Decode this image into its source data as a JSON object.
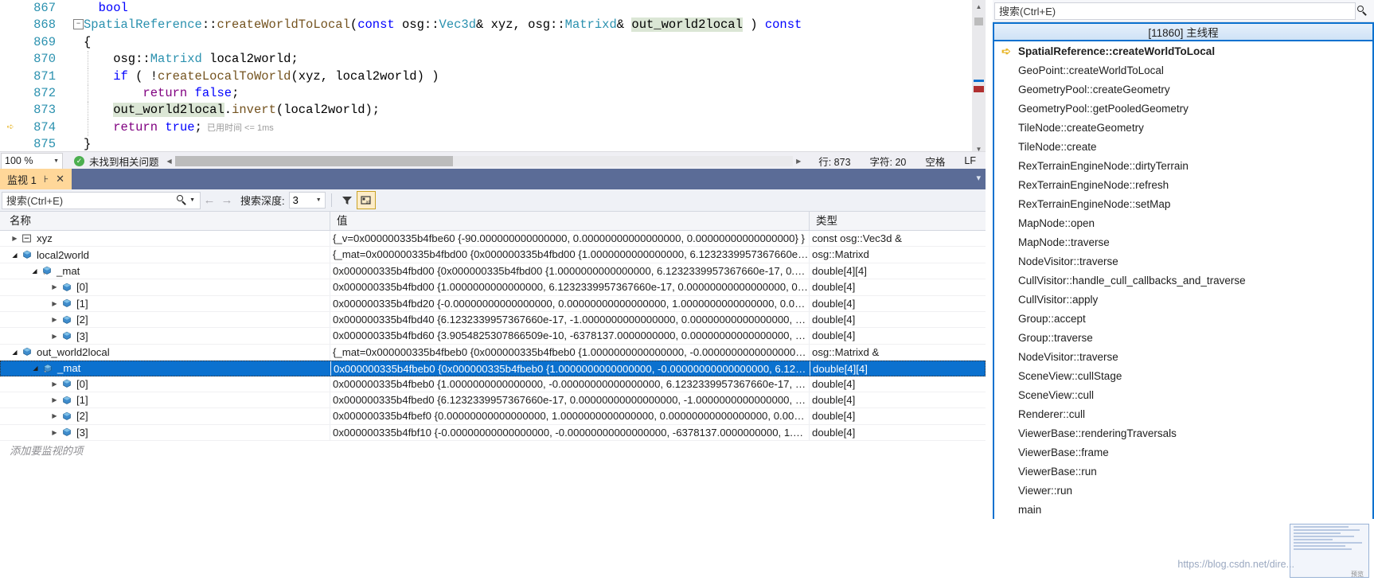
{
  "editor": {
    "lines": [
      {
        "num": "867",
        "fold": false,
        "current": false,
        "indent": false,
        "segments": [
          {
            "t": "  bool",
            "c": "kw"
          }
        ]
      },
      {
        "num": "868",
        "fold": true,
        "current": false,
        "indent": false,
        "segments": [
          {
            "t": "SpatialReference",
            "c": "typ"
          },
          {
            "t": "::",
            "c": ""
          },
          {
            "t": "createWorldToLocal",
            "c": "fn"
          },
          {
            "t": "(",
            "c": ""
          },
          {
            "t": "const",
            "c": "kw"
          },
          {
            "t": " osg::",
            "c": ""
          },
          {
            "t": "Vec3d",
            "c": "typ"
          },
          {
            "t": "& xyz, osg::",
            "c": ""
          },
          {
            "t": "Matrixd",
            "c": "typ"
          },
          {
            "t": "& ",
            "c": ""
          },
          {
            "t": "out_world2local",
            "c": "hl"
          },
          {
            "t": " ) ",
            "c": ""
          },
          {
            "t": "const",
            "c": "kw"
          }
        ]
      },
      {
        "num": "869",
        "fold": false,
        "current": false,
        "indent": false,
        "segments": [
          {
            "t": "{",
            "c": ""
          }
        ]
      },
      {
        "num": "870",
        "fold": false,
        "current": false,
        "indent": true,
        "segments": [
          {
            "t": "    osg::",
            "c": ""
          },
          {
            "t": "Matrixd",
            "c": "typ"
          },
          {
            "t": " local2world;",
            "c": ""
          }
        ]
      },
      {
        "num": "871",
        "fold": false,
        "current": false,
        "indent": true,
        "segments": [
          {
            "t": "    ",
            "c": ""
          },
          {
            "t": "if",
            "c": "kw"
          },
          {
            "t": " ( !",
            "c": ""
          },
          {
            "t": "createLocalToWorld",
            "c": "fn"
          },
          {
            "t": "(xyz, local2world) )",
            "c": ""
          }
        ]
      },
      {
        "num": "872",
        "fold": false,
        "current": false,
        "indent": true,
        "segments": [
          {
            "t": "        ",
            "c": ""
          },
          {
            "t": "return",
            "c": "mac"
          },
          {
            "t": " ",
            "c": ""
          },
          {
            "t": "false",
            "c": "kw"
          },
          {
            "t": ";",
            "c": ""
          }
        ]
      },
      {
        "num": "873",
        "fold": false,
        "current": false,
        "indent": true,
        "segments": [
          {
            "t": "    ",
            "c": ""
          },
          {
            "t": "out_world2local",
            "c": "hl"
          },
          {
            "t": ".",
            "c": ""
          },
          {
            "t": "invert",
            "c": "fn"
          },
          {
            "t": "(local2world);",
            "c": ""
          }
        ]
      },
      {
        "num": "874",
        "fold": false,
        "current": true,
        "indent": true,
        "segments": [
          {
            "t": "    ",
            "c": ""
          },
          {
            "t": "return",
            "c": "mac"
          },
          {
            "t": " ",
            "c": ""
          },
          {
            "t": "true",
            "c": "kw"
          },
          {
            "t": ";",
            "c": ""
          }
        ],
        "tooltip": "已用时间 <= 1ms"
      },
      {
        "num": "875",
        "fold": false,
        "current": false,
        "indent": false,
        "segments": [
          {
            "t": "}",
            "c": ""
          }
        ]
      }
    ],
    "status": {
      "zoom": "100 %",
      "issues": "未找到相关问题",
      "line": "行: 873",
      "column": "字符: 20",
      "spaces": "空格",
      "eol": "LF"
    }
  },
  "watch": {
    "tab_label": "监视 1",
    "pin_icon": "pin-icon",
    "close_icon": "close-icon",
    "search_placeholder": "搜索(Ctrl+E)",
    "depth_label": "搜索深度:",
    "depth_value": "3",
    "toolbar_icons": [
      "filter-icon",
      "hex-display-icon"
    ],
    "columns": [
      "名称",
      "值",
      "类型"
    ],
    "add_item_hint": "添加要监视的项",
    "rows": [
      {
        "indent": 0,
        "twisty": "collapsed",
        "icon": "struct-icon",
        "name": "xyz",
        "value": "{_v=0x000000335b4fbe60 {-90.000000000000000, 0.00000000000000000, 0.00000000000000000} }",
        "type": "const osg::Vec3d &",
        "selected": false
      },
      {
        "indent": 0,
        "twisty": "expanded",
        "icon": "field-icon",
        "name": "local2world",
        "value": "{_mat=0x000000335b4fbd00 {0x000000335b4fbd00 {1.0000000000000000, 6.1232339957367660e-…",
        "type": "osg::Matrixd",
        "selected": false
      },
      {
        "indent": 1,
        "twisty": "expanded",
        "icon": "private-field-icon",
        "name": "_mat",
        "value": "0x000000335b4fbd00 {0x000000335b4fbd00 {1.0000000000000000, 6.1232339957367660e-17, 0.0…",
        "type": "double[4][4]",
        "selected": false
      },
      {
        "indent": 2,
        "twisty": "collapsed",
        "icon": "field-icon",
        "name": "[0]",
        "value": "0x000000335b4fbd00 {1.0000000000000000, 6.1232339957367660e-17, 0.00000000000000000, 0.0…",
        "type": "double[4]",
        "selected": false
      },
      {
        "indent": 2,
        "twisty": "collapsed",
        "icon": "field-icon",
        "name": "[1]",
        "value": "0x000000335b4fbd20 {-0.00000000000000000, 0.00000000000000000, 1.0000000000000000, 0.000…",
        "type": "double[4]",
        "selected": false
      },
      {
        "indent": 2,
        "twisty": "collapsed",
        "icon": "field-icon",
        "name": "[2]",
        "value": "0x000000335b4fbd40 {6.1232339957367660e-17, -1.0000000000000000, 0.00000000000000000, 0…",
        "type": "double[4]",
        "selected": false
      },
      {
        "indent": 2,
        "twisty": "collapsed",
        "icon": "field-icon",
        "name": "[3]",
        "value": "0x000000335b4fbd60 {3.9054825307866509e-10, -6378137.0000000000, 0.00000000000000000, 1…",
        "type": "double[4]",
        "selected": false
      },
      {
        "indent": 0,
        "twisty": "expanded",
        "icon": "field-icon",
        "name": "out_world2local",
        "value": "{_mat=0x000000335b4fbeb0 {0x000000335b4fbeb0 {1.0000000000000000, -0.00000000000000000…",
        "type": "osg::Matrixd &",
        "selected": false
      },
      {
        "indent": 1,
        "twisty": "expanded",
        "icon": "private-field-icon",
        "name": "_mat",
        "value": "0x000000335b4fbeb0 {0x000000335b4fbeb0 {1.0000000000000000, -0.00000000000000000, 6.123…",
        "type": "double[4][4]",
        "selected": true
      },
      {
        "indent": 2,
        "twisty": "collapsed",
        "icon": "field-icon",
        "name": "[0]",
        "value": "0x000000335b4fbeb0 {1.0000000000000000, -0.00000000000000000, 6.1232339957367660e-17, 0…",
        "type": "double[4]",
        "selected": false
      },
      {
        "indent": 2,
        "twisty": "collapsed",
        "icon": "field-icon",
        "name": "[1]",
        "value": "0x000000335b4fbed0 {6.1232339957367660e-17, 0.00000000000000000, -1.0000000000000000, 0…",
        "type": "double[4]",
        "selected": false
      },
      {
        "indent": 2,
        "twisty": "collapsed",
        "icon": "field-icon",
        "name": "[2]",
        "value": "0x000000335b4fbef0 {0.00000000000000000, 1.0000000000000000, 0.00000000000000000, 0.0000…",
        "type": "double[4]",
        "selected": false
      },
      {
        "indent": 2,
        "twisty": "collapsed",
        "icon": "field-icon",
        "name": "[3]",
        "value": "0x000000335b4fbf10 {-0.00000000000000000, -0.00000000000000000, -6378137.0000000000, 1.00…",
        "type": "double[4]",
        "selected": false
      }
    ]
  },
  "callstack": {
    "search_placeholder": "搜索(Ctrl+E)",
    "thread_header": "[11860] 主线程",
    "frames": [
      {
        "name": "SpatialReference::createWorldToLocal",
        "current": true
      },
      {
        "name": "GeoPoint::createWorldToLocal",
        "current": false
      },
      {
        "name": "GeometryPool::createGeometry",
        "current": false
      },
      {
        "name": "GeometryPool::getPooledGeometry",
        "current": false
      },
      {
        "name": "TileNode::createGeometry",
        "current": false
      },
      {
        "name": "TileNode::create",
        "current": false
      },
      {
        "name": "RexTerrainEngineNode::dirtyTerrain",
        "current": false
      },
      {
        "name": "RexTerrainEngineNode::refresh",
        "current": false
      },
      {
        "name": "RexTerrainEngineNode::setMap",
        "current": false
      },
      {
        "name": "MapNode::open",
        "current": false
      },
      {
        "name": "MapNode::traverse",
        "current": false
      },
      {
        "name": "NodeVisitor::traverse",
        "current": false
      },
      {
        "name": "CullVisitor::handle_cull_callbacks_and_traverse",
        "current": false
      },
      {
        "name": "CullVisitor::apply",
        "current": false
      },
      {
        "name": "Group::accept",
        "current": false
      },
      {
        "name": "Group::traverse",
        "current": false
      },
      {
        "name": "NodeVisitor::traverse",
        "current": false
      },
      {
        "name": "SceneView::cullStage",
        "current": false
      },
      {
        "name": "SceneView::cull",
        "current": false
      },
      {
        "name": "Renderer::cull",
        "current": false
      },
      {
        "name": "ViewerBase::renderingTraversals",
        "current": false
      },
      {
        "name": "ViewerBase::frame",
        "current": false
      },
      {
        "name": "ViewerBase::run",
        "current": false
      },
      {
        "name": "Viewer::run",
        "current": false
      },
      {
        "name": "main",
        "current": false
      }
    ],
    "watermark_url": "https://blog.csdn.net/dire..."
  },
  "colors": {
    "accent": "#0b71cf",
    "tab_active": "#ffd799",
    "tabstrip": "#5b6c97",
    "keyword": "#0000ff",
    "type": "#2b91af",
    "function": "#74531f",
    "macro": "#800080",
    "highlight": "#dbe6d5"
  }
}
